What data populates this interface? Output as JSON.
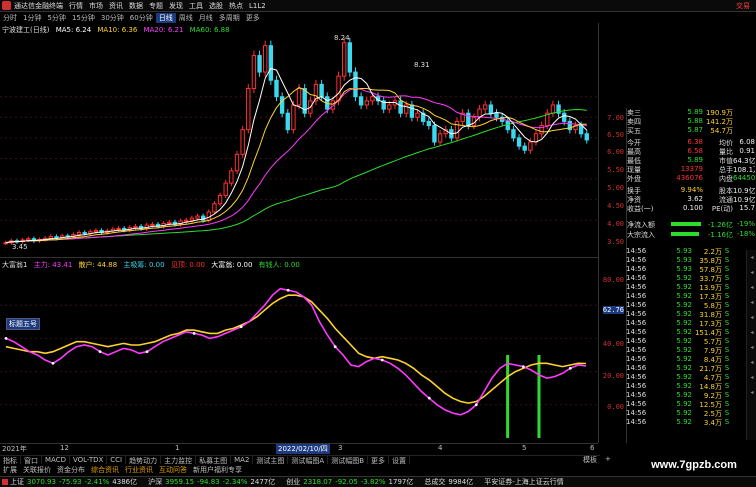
{
  "menubar": {
    "title": "通达信金融终端",
    "items": [
      "行情",
      "市场",
      "资讯",
      "数据",
      "专题",
      "发现",
      "工具",
      "选股",
      "热点",
      "L1L2"
    ],
    "trade": "交易"
  },
  "periods": [
    "分时",
    "1分钟",
    "5分钟",
    "15分钟",
    "30分钟",
    "60分钟",
    "日线",
    "周线",
    "月线",
    "多周期",
    "更多"
  ],
  "period_selected": "日线",
  "main": {
    "stock": "宁波建工(日线)",
    "ma_legend": [
      {
        "label": "MA5: 6.24",
        "color": "#ffffff"
      },
      {
        "label": "MA10: 6.36",
        "color": "#ffd22e"
      },
      {
        "label": "MA20: 6.21",
        "color": "#ff3aff"
      },
      {
        "label": "MA60: 6.88",
        "color": "#2edc2e"
      }
    ],
    "annot_high1": "8.24",
    "annot_high2": "8.31",
    "annot_low": "3.45"
  },
  "indicator": {
    "name": "大富翁1",
    "legend": [
      {
        "label": "主力: 43.41",
        "color": "#ff3aff"
      },
      {
        "label": "散户: 44.88",
        "color": "#ffd22e"
      },
      {
        "label": "主吸筹: 0.00",
        "color": "#3ad9f0"
      },
      {
        "label": "见顶: 0.00",
        "color": "#ff3030"
      },
      {
        "label": "大富翁: 0.00",
        "color": "#ffffff"
      },
      {
        "label": "有钱人: 0.00",
        "color": "#2edc2e"
      }
    ],
    "badge": "标题五号",
    "current": "62.76"
  },
  "axis_main": [
    "7.00",
    "6.50",
    "6.00",
    "5.50",
    "5.00",
    "4.50",
    "4.00",
    "3.50"
  ],
  "axis_ind": [
    "80.00",
    "60.00",
    "40.00",
    "20.00",
    "0.00"
  ],
  "quote": [
    [
      "卖三",
      "5.89",
      "190.9万",
      ""
    ],
    [
      "卖四",
      "5.88",
      "141.2万",
      ""
    ],
    [
      "买五",
      "5.87",
      "54.7万",
      ""
    ],
    [
      "今开",
      "6.38",
      "均价",
      "6.08"
    ],
    [
      "最高",
      "6.58",
      "量比",
      "0.91"
    ],
    [
      "最低",
      "5.89",
      "市值",
      "64.3亿"
    ],
    [
      "现量",
      "13379",
      "总手",
      "108.1万"
    ],
    [
      "外盘",
      "436076",
      "内盘",
      "644506"
    ],
    [
      "换手",
      "9.94%",
      "股本",
      "10.9亿"
    ],
    [
      "净资",
      "3.62",
      "流通",
      "10.9亿"
    ],
    [
      "收益(一)",
      "0.100",
      "PE(动)",
      "15.7"
    ],
    [
      "净流入额",
      "",
      "-1.26亿",
      "-19%"
    ],
    [
      "大宗流入",
      "",
      "-1.16亿",
      "-18%"
    ]
  ],
  "ticks": [
    [
      "14:56",
      "5.93",
      "2.2万",
      "S"
    ],
    [
      "14:56",
      "5.93",
      "35.8万",
      "S"
    ],
    [
      "14:56",
      "5.93",
      "57.8万",
      "S"
    ],
    [
      "14:56",
      "5.92",
      "33.7万",
      "S"
    ],
    [
      "14:56",
      "5.92",
      "13.9万",
      "S"
    ],
    [
      "14:56",
      "5.92",
      "17.3万",
      "S"
    ],
    [
      "14:56",
      "5.92",
      "5.8万",
      "S"
    ],
    [
      "14:56",
      "5.92",
      "31.8万",
      "S"
    ],
    [
      "14:56",
      "5.92",
      "17.3万",
      "S"
    ],
    [
      "14:56",
      "5.92",
      "151.4万",
      "S"
    ],
    [
      "14:56",
      "5.92",
      "5.7万",
      "S"
    ],
    [
      "14:56",
      "5.92",
      "7.9万",
      "S"
    ],
    [
      "14:56",
      "5.92",
      "8.4万",
      "S"
    ],
    [
      "14:56",
      "5.92",
      "21.7万",
      "S"
    ],
    [
      "14:56",
      "5.92",
      "4.7万",
      "S"
    ],
    [
      "14:56",
      "5.92",
      "14.8万",
      "S"
    ],
    [
      "14:56",
      "5.92",
      "9.2万",
      "S"
    ],
    [
      "14:56",
      "5.92",
      "12.5万",
      "S"
    ],
    [
      "14:56",
      "5.92",
      "2.5万",
      "S"
    ],
    [
      "14:56",
      "5.92",
      "3.4万",
      "S"
    ]
  ],
  "dates": [
    "2021年",
    "12",
    "1",
    "2022/02/10/四",
    "3",
    "4",
    "5",
    "6"
  ],
  "tabs1": [
    "指标",
    "窗口",
    "MACD",
    "VOL-TDX",
    "CCI",
    "趋势动力",
    "主力监控",
    "私募主图",
    "MA2",
    "测试主图",
    "测试幅图A",
    "测试幅图B",
    "更多",
    "设置"
  ],
  "tabs2": [
    "扩展",
    "关联报价",
    "资金分布",
    "综合资讯",
    "行业资讯",
    "互动问答",
    "新用户福利专享"
  ],
  "tabs_right": [
    "模板",
    "+"
  ],
  "status": [
    {
      "t": "上证",
      "c": "#ddd"
    },
    {
      "t": "3070.93",
      "c": "#2edc2e"
    },
    {
      "t": "-75.93",
      "c": "#2edc2e"
    },
    {
      "t": "-2.41%",
      "c": "#2edc2e"
    },
    {
      "t": "4386亿",
      "c": "#ddd"
    },
    {
      "t": "沪深",
      "c": "#ddd"
    },
    {
      "t": "3959.15",
      "c": "#2edc2e"
    },
    {
      "t": "-94.83",
      "c": "#2edc2e"
    },
    {
      "t": "-2.34%",
      "c": "#2edc2e"
    },
    {
      "t": "2477亿",
      "c": "#ddd"
    },
    {
      "t": "创业",
      "c": "#ddd"
    },
    {
      "t": "2318.07",
      "c": "#2edc2e"
    },
    {
      "t": "-92.05",
      "c": "#2edc2e"
    },
    {
      "t": "-3.82%",
      "c": "#2edc2e"
    },
    {
      "t": "1797亿",
      "c": "#ddd"
    },
    {
      "t": "总成交",
      "c": "#ddd"
    },
    {
      "t": "9984亿",
      "c": "#ddd"
    },
    {
      "t": "平安证券-上海上证云行情",
      "c": "#ddd"
    }
  ],
  "watermark": "www.7gpzb.com",
  "colors": {
    "up": "#ff3030",
    "down": "#3ad9f0",
    "ma5": "#ffffff",
    "ma10": "#ffd22e",
    "ma20": "#ff3aff",
    "ma60": "#2edc2e",
    "bg": "#000000"
  },
  "chart_data": {
    "type": "candlestick",
    "ylim": [
      3.3,
      8.5
    ],
    "closes": [
      3.45,
      3.5,
      3.48,
      3.52,
      3.55,
      3.5,
      3.53,
      3.56,
      3.6,
      3.58,
      3.62,
      3.6,
      3.65,
      3.7,
      3.68,
      3.72,
      3.75,
      3.7,
      3.74,
      3.78,
      3.8,
      3.76,
      3.82,
      3.85,
      3.8,
      3.88,
      3.9,
      3.85,
      3.92,
      3.95,
      3.9,
      3.98,
      4.0,
      4.05,
      4.1,
      4.0,
      4.2,
      4.4,
      4.6,
      4.9,
      5.2,
      5.6,
      6.2,
      7.2,
      8.0,
      7.6,
      8.24,
      7.4,
      7.0,
      6.6,
      6.2,
      6.8,
      7.2,
      6.6,
      6.9,
      7.3,
      7.0,
      6.7,
      6.9,
      7.5,
      8.31,
      7.6,
      7.0,
      6.8,
      6.9,
      7.0,
      6.9,
      6.7,
      6.8,
      6.9,
      6.6,
      6.8,
      6.5,
      6.6,
      6.4,
      6.3,
      5.9,
      6.1,
      6.2,
      6.0,
      6.4,
      6.6,
      6.3,
      6.5,
      6.7,
      6.8,
      6.6,
      6.5,
      6.4,
      6.2,
      6.0,
      5.8,
      5.7,
      5.9,
      6.1,
      6.3,
      6.6,
      6.8,
      6.6,
      6.4,
      6.2,
      6.3,
      6.1,
      5.95
    ],
    "ind_ylim": [
      0,
      100
    ],
    "mainforce": [
      60,
      58,
      55,
      52,
      50,
      47,
      45,
      48,
      52,
      55,
      56,
      55,
      52,
      50,
      52,
      54,
      53,
      51,
      52,
      55,
      58,
      60,
      62,
      64,
      63,
      62,
      60,
      61,
      63,
      65,
      67,
      70,
      75,
      80,
      86,
      90,
      89,
      88,
      85,
      80,
      70,
      62,
      55,
      50,
      44,
      43,
      46,
      48,
      47,
      45,
      42,
      38,
      33,
      28,
      24,
      20,
      17,
      15,
      14,
      16,
      20,
      28,
      36,
      42,
      45,
      44,
      43,
      41,
      38,
      36,
      37,
      39,
      42,
      44,
      43.4
    ],
    "retail": [
      55,
      54,
      53,
      52,
      52,
      51,
      52,
      54,
      56,
      58,
      58,
      57,
      56,
      55,
      56,
      57,
      56,
      56,
      57,
      58,
      60,
      62,
      63,
      65,
      65,
      64,
      63,
      63,
      65,
      66,
      68,
      70,
      73,
      77,
      81,
      84,
      86,
      86,
      85,
      82,
      77,
      72,
      66,
      61,
      56,
      51,
      49,
      48,
      49,
      48,
      47,
      45,
      42,
      38,
      35,
      31,
      27,
      24,
      22,
      21,
      22,
      25,
      29,
      33,
      37,
      40,
      42,
      44,
      45,
      45,
      44,
      43,
      44,
      45,
      44.9
    ],
    "signals": [
      22,
      24
    ]
  }
}
